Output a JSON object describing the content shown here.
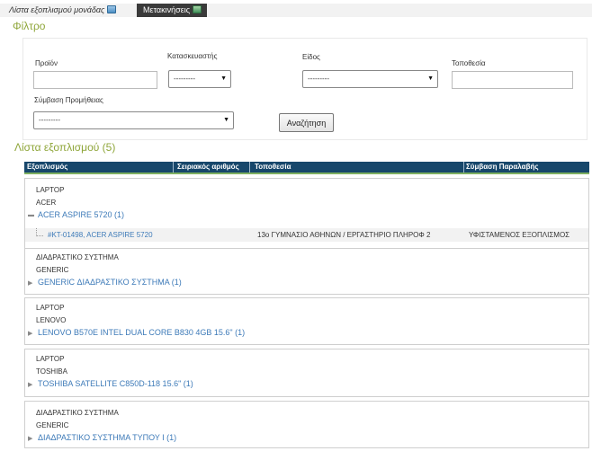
{
  "tabs": [
    {
      "label": "Λίστα εξοπλισμού μονάδας",
      "icon": "equipment-list-icon"
    },
    {
      "label": "Μετακινήσεις",
      "icon": "transfer-icon"
    }
  ],
  "filter": {
    "title": "Φίλτρο",
    "product_label": "Προϊόν",
    "product_value": "",
    "manufacturer_label": "Κατασκευαστής",
    "manufacturer_value": "---------",
    "type_label": "Είδος",
    "type_value": "---------",
    "location_label": "Τοποθεσία",
    "location_value": "",
    "contract_label": "Σύμβαση Προμήθειας",
    "contract_value": "---------",
    "search_label": "Αναζήτηση"
  },
  "list": {
    "title": "Λίστα εξοπλισμού (5)",
    "columns": [
      "Εξοπλισμός",
      "Σειριακός αριθμός",
      "Τοποθεσία",
      "Σύμβαση Παραλαβής"
    ],
    "groups": [
      {
        "type": "LAPTOP",
        "manufacturer": "ACER",
        "product": "ACER ASPIRE 5720 (1)",
        "expanded": true,
        "child": {
          "name": "#KT-01498, ACER ASPIRE 5720",
          "location": "13ο ΓΥΜΝΑΣΙΟ ΑΘΗΝΩΝ / ΕΡΓΑΣΤΗΡΙΟ ΠΛΗΡΟΦ 2",
          "contract": "ΥΦΙΣΤΑΜΕΝΟΣ ΕΞΟΠΛΙΣΜΟΣ"
        }
      },
      {
        "type": "ΔΙΑΔΡΑΣΤΙΚΟ ΣΥΣΤΗΜΑ",
        "manufacturer": "GENERIC",
        "product": "GENERIC ΔΙΑΔΡΑΣΤΙΚΟ ΣΥΣΤΗΜΑ (1)",
        "expanded": false
      },
      {
        "type": "LAPTOP",
        "manufacturer": "LENOVO",
        "product": "LENOVO B570E INTEL DUAL CORE B830 4GB 15.6\" (1)",
        "expanded": false
      },
      {
        "type": "LAPTOP",
        "manufacturer": "TOSHIBA",
        "product": "TOSHIBA SATELLITE C850D-118 15.6\" (1)",
        "expanded": false
      },
      {
        "type": "ΔΙΑΔΡΑΣΤΙΚΟ ΣΥΣΤΗΜΑ",
        "manufacturer": "GENERIC",
        "product": "ΔΙΑΔΡΑΣΤΙΚΟ ΣΥΣΤΗΜΑ ΤΥΠΟΥ Ι (1)",
        "expanded": false
      }
    ]
  },
  "colors": {
    "section_title": "#8fa63a",
    "header_bg": "#17476b",
    "link": "#3d7ab8"
  }
}
